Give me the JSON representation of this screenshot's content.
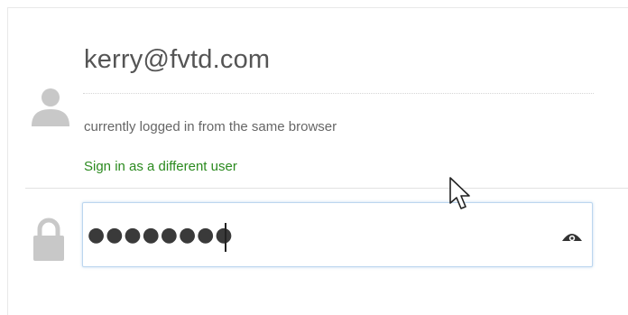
{
  "account": {
    "email": "kerry@fvtd.com",
    "status": "currently logged in from the same browser",
    "switch_user_label": "Sign in as a different user"
  },
  "password": {
    "value": "●●●●●●●●",
    "toggle_icon": "eye-icon"
  },
  "icons": {
    "user": "user-silhouette-icon",
    "lock": "lock-icon",
    "cursor": "mouse-pointer-icon"
  },
  "colors": {
    "link": "#2b8a1f",
    "text": "#555555",
    "icon_gray": "#c8c8c8",
    "focus_border": "#bcd6ef"
  }
}
